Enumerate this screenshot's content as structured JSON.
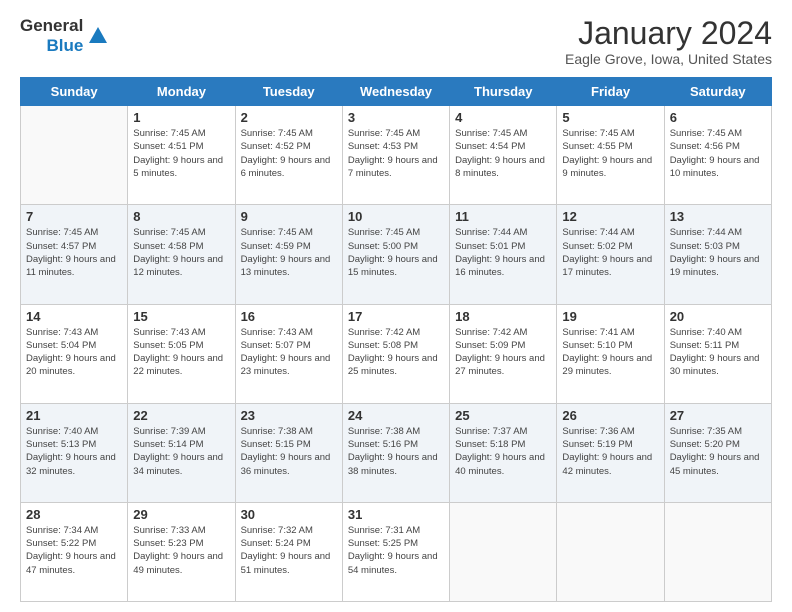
{
  "header": {
    "logo_general": "General",
    "logo_blue": "Blue",
    "month_title": "January 2024",
    "location": "Eagle Grove, Iowa, United States"
  },
  "days_of_week": [
    "Sunday",
    "Monday",
    "Tuesday",
    "Wednesday",
    "Thursday",
    "Friday",
    "Saturday"
  ],
  "weeks": [
    [
      {
        "day": "",
        "empty": true
      },
      {
        "day": "1",
        "sunrise": "Sunrise: 7:45 AM",
        "sunset": "Sunset: 4:51 PM",
        "daylight": "Daylight: 9 hours and 5 minutes."
      },
      {
        "day": "2",
        "sunrise": "Sunrise: 7:45 AM",
        "sunset": "Sunset: 4:52 PM",
        "daylight": "Daylight: 9 hours and 6 minutes."
      },
      {
        "day": "3",
        "sunrise": "Sunrise: 7:45 AM",
        "sunset": "Sunset: 4:53 PM",
        "daylight": "Daylight: 9 hours and 7 minutes."
      },
      {
        "day": "4",
        "sunrise": "Sunrise: 7:45 AM",
        "sunset": "Sunset: 4:54 PM",
        "daylight": "Daylight: 9 hours and 8 minutes."
      },
      {
        "day": "5",
        "sunrise": "Sunrise: 7:45 AM",
        "sunset": "Sunset: 4:55 PM",
        "daylight": "Daylight: 9 hours and 9 minutes."
      },
      {
        "day": "6",
        "sunrise": "Sunrise: 7:45 AM",
        "sunset": "Sunset: 4:56 PM",
        "daylight": "Daylight: 9 hours and 10 minutes."
      }
    ],
    [
      {
        "day": "7",
        "sunrise": "Sunrise: 7:45 AM",
        "sunset": "Sunset: 4:57 PM",
        "daylight": "Daylight: 9 hours and 11 minutes."
      },
      {
        "day": "8",
        "sunrise": "Sunrise: 7:45 AM",
        "sunset": "Sunset: 4:58 PM",
        "daylight": "Daylight: 9 hours and 12 minutes."
      },
      {
        "day": "9",
        "sunrise": "Sunrise: 7:45 AM",
        "sunset": "Sunset: 4:59 PM",
        "daylight": "Daylight: 9 hours and 13 minutes."
      },
      {
        "day": "10",
        "sunrise": "Sunrise: 7:45 AM",
        "sunset": "Sunset: 5:00 PM",
        "daylight": "Daylight: 9 hours and 15 minutes."
      },
      {
        "day": "11",
        "sunrise": "Sunrise: 7:44 AM",
        "sunset": "Sunset: 5:01 PM",
        "daylight": "Daylight: 9 hours and 16 minutes."
      },
      {
        "day": "12",
        "sunrise": "Sunrise: 7:44 AM",
        "sunset": "Sunset: 5:02 PM",
        "daylight": "Daylight: 9 hours and 17 minutes."
      },
      {
        "day": "13",
        "sunrise": "Sunrise: 7:44 AM",
        "sunset": "Sunset: 5:03 PM",
        "daylight": "Daylight: 9 hours and 19 minutes."
      }
    ],
    [
      {
        "day": "14",
        "sunrise": "Sunrise: 7:43 AM",
        "sunset": "Sunset: 5:04 PM",
        "daylight": "Daylight: 9 hours and 20 minutes."
      },
      {
        "day": "15",
        "sunrise": "Sunrise: 7:43 AM",
        "sunset": "Sunset: 5:05 PM",
        "daylight": "Daylight: 9 hours and 22 minutes."
      },
      {
        "day": "16",
        "sunrise": "Sunrise: 7:43 AM",
        "sunset": "Sunset: 5:07 PM",
        "daylight": "Daylight: 9 hours and 23 minutes."
      },
      {
        "day": "17",
        "sunrise": "Sunrise: 7:42 AM",
        "sunset": "Sunset: 5:08 PM",
        "daylight": "Daylight: 9 hours and 25 minutes."
      },
      {
        "day": "18",
        "sunrise": "Sunrise: 7:42 AM",
        "sunset": "Sunset: 5:09 PM",
        "daylight": "Daylight: 9 hours and 27 minutes."
      },
      {
        "day": "19",
        "sunrise": "Sunrise: 7:41 AM",
        "sunset": "Sunset: 5:10 PM",
        "daylight": "Daylight: 9 hours and 29 minutes."
      },
      {
        "day": "20",
        "sunrise": "Sunrise: 7:40 AM",
        "sunset": "Sunset: 5:11 PM",
        "daylight": "Daylight: 9 hours and 30 minutes."
      }
    ],
    [
      {
        "day": "21",
        "sunrise": "Sunrise: 7:40 AM",
        "sunset": "Sunset: 5:13 PM",
        "daylight": "Daylight: 9 hours and 32 minutes."
      },
      {
        "day": "22",
        "sunrise": "Sunrise: 7:39 AM",
        "sunset": "Sunset: 5:14 PM",
        "daylight": "Daylight: 9 hours and 34 minutes."
      },
      {
        "day": "23",
        "sunrise": "Sunrise: 7:38 AM",
        "sunset": "Sunset: 5:15 PM",
        "daylight": "Daylight: 9 hours and 36 minutes."
      },
      {
        "day": "24",
        "sunrise": "Sunrise: 7:38 AM",
        "sunset": "Sunset: 5:16 PM",
        "daylight": "Daylight: 9 hours and 38 minutes."
      },
      {
        "day": "25",
        "sunrise": "Sunrise: 7:37 AM",
        "sunset": "Sunset: 5:18 PM",
        "daylight": "Daylight: 9 hours and 40 minutes."
      },
      {
        "day": "26",
        "sunrise": "Sunrise: 7:36 AM",
        "sunset": "Sunset: 5:19 PM",
        "daylight": "Daylight: 9 hours and 42 minutes."
      },
      {
        "day": "27",
        "sunrise": "Sunrise: 7:35 AM",
        "sunset": "Sunset: 5:20 PM",
        "daylight": "Daylight: 9 hours and 45 minutes."
      }
    ],
    [
      {
        "day": "28",
        "sunrise": "Sunrise: 7:34 AM",
        "sunset": "Sunset: 5:22 PM",
        "daylight": "Daylight: 9 hours and 47 minutes."
      },
      {
        "day": "29",
        "sunrise": "Sunrise: 7:33 AM",
        "sunset": "Sunset: 5:23 PM",
        "daylight": "Daylight: 9 hours and 49 minutes."
      },
      {
        "day": "30",
        "sunrise": "Sunrise: 7:32 AM",
        "sunset": "Sunset: 5:24 PM",
        "daylight": "Daylight: 9 hours and 51 minutes."
      },
      {
        "day": "31",
        "sunrise": "Sunrise: 7:31 AM",
        "sunset": "Sunset: 5:25 PM",
        "daylight": "Daylight: 9 hours and 54 minutes."
      },
      {
        "day": "",
        "empty": true
      },
      {
        "day": "",
        "empty": true
      },
      {
        "day": "",
        "empty": true
      }
    ]
  ]
}
